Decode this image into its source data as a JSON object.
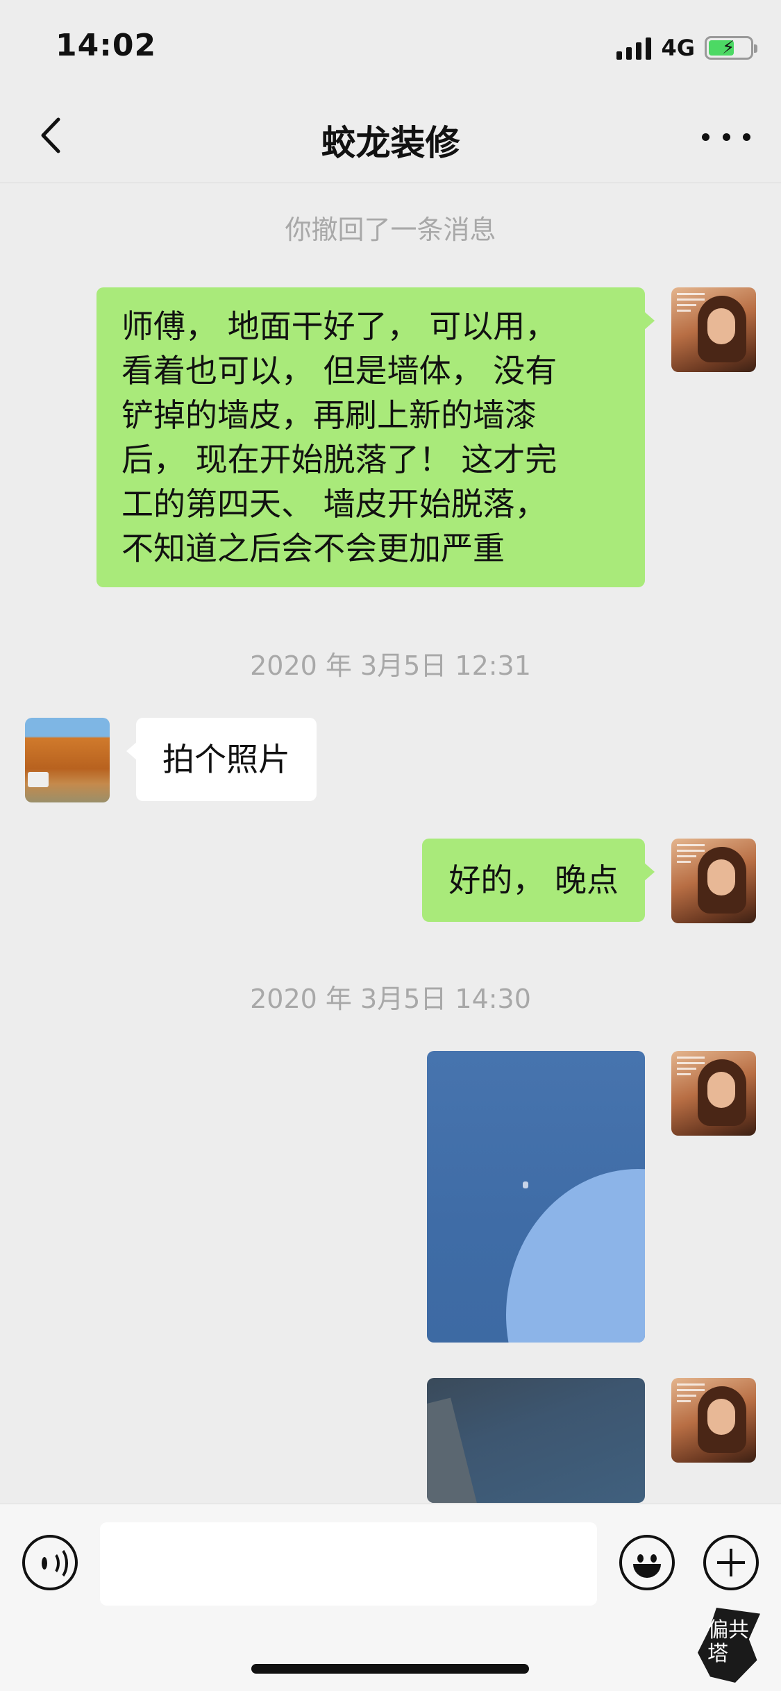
{
  "status_bar": {
    "time": "14:02",
    "network": "4G",
    "icons": [
      "signal-icon",
      "battery-charging-icon"
    ]
  },
  "nav": {
    "title": "蛟龙装修",
    "back_icon": "chevron-left-icon",
    "more_icon": "more-horizontal-icon"
  },
  "messages": {
    "recall_notice": "你撤回了一条消息",
    "msg1": {
      "sender": "me",
      "lines": [
        "师傅， 地面干好了， 可以用，",
        "看着也可以， 但是墙体， 没有",
        "铲掉的墙皮，再刷上新的墙漆",
        "后， 现在开始脱落了！ 这才完",
        "工的第四天、 墙皮开始脱落，",
        "不知道之后会不会更加严重"
      ]
    },
    "timestamp1": "2020 年 3月5日 12:31",
    "msg2": {
      "sender": "other",
      "text": "拍个照片"
    },
    "msg3": {
      "sender": "me",
      "text": "好的， 晚点"
    },
    "timestamp2": "2020 年 3月5日 14:30",
    "photo1": {
      "sender": "me",
      "type": "image"
    },
    "photo2": {
      "sender": "me",
      "type": "image"
    }
  },
  "input_bar": {
    "voice_icon": "voice-icon",
    "emoji_icon": "emoji-icon",
    "plus_icon": "plus-icon",
    "placeholder": ""
  },
  "watermark": {
    "text": "偏共塔"
  },
  "colors": {
    "background": "#ededed",
    "bubble_me": "#a9ea7a",
    "bubble_other": "#ffffff",
    "system_text": "#a8a8a8"
  }
}
